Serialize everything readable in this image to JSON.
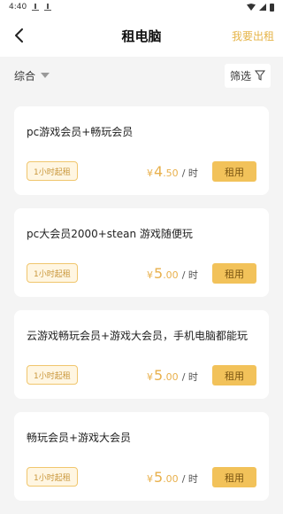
{
  "status": {
    "time": "4:40"
  },
  "nav": {
    "title": "租电脑",
    "action": "我要出租"
  },
  "filters": {
    "sort_label": "综合",
    "filter_label": "筛选"
  },
  "items": [
    {
      "title": "pc游戏会员+畅玩会员",
      "tag": "1小时起租",
      "currency": "¥",
      "price_int": "4",
      "price_dec": ".50",
      "unit": "/ 时",
      "button": "租用"
    },
    {
      "title": "pc大会员2000+stean 游戏随便玩",
      "tag": "1小时起租",
      "currency": "¥",
      "price_int": "5",
      "price_dec": ".00",
      "unit": "/ 时",
      "button": "租用"
    },
    {
      "title": "云游戏畅玩会员+游戏大会员，手机电脑都能玩",
      "tag": "1小时起租",
      "currency": "¥",
      "price_int": "5",
      "price_dec": ".00",
      "unit": "/ 时",
      "button": "租用"
    },
    {
      "title": "畅玩会员+游戏大会员",
      "tag": "1小时起租",
      "currency": "¥",
      "price_int": "5",
      "price_dec": ".00",
      "unit": "/ 时",
      "button": "租用"
    }
  ]
}
